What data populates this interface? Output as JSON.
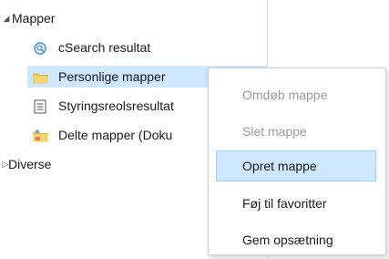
{
  "tree": {
    "root_label": "Mapper",
    "items": [
      {
        "label": "cSearch resultat",
        "icon": "search-results-icon"
      },
      {
        "label": "Personlige mapper",
        "icon": "folder-icon",
        "selected": true
      },
      {
        "label": "Styringsreolsresultat",
        "icon": "document-list-icon"
      },
      {
        "label": "Delte mapper (Doku",
        "icon": "shared-folder-icon"
      }
    ],
    "second_root_label": "Diverse"
  },
  "context_menu": {
    "items": [
      {
        "label": "Omdøb mappe",
        "disabled": true
      },
      {
        "label": "Slet mappe",
        "disabled": true
      },
      {
        "label": "Opret mappe",
        "hover": true
      },
      {
        "label": "Føj til favoritter"
      },
      {
        "label": "Gem opsætning"
      }
    ]
  },
  "colors": {
    "selection": "#cde8ff",
    "folder": "#f2c94c",
    "disabled_text": "#9a9a9a"
  }
}
